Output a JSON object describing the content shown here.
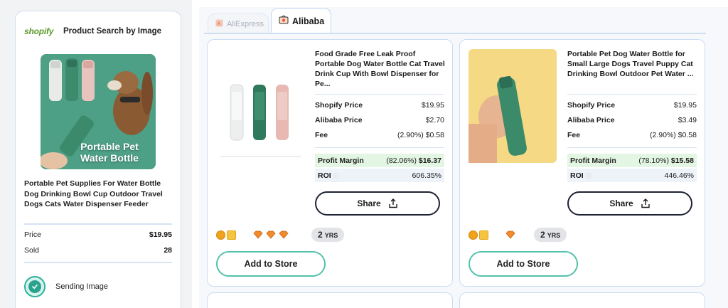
{
  "left_panel": {
    "brand": "shopify",
    "title": "Product Search by Image",
    "image_caption": "Portable Pet Water Bottle",
    "product_name": "Portable Pet Supplies For Water Bottle Dog Drinking Bowl Cup Outdoor Travel Dogs Cats Water Dispenser Feeder",
    "price_label": "Price",
    "price_value": "$19.95",
    "sold_label": "Sold",
    "sold_value": "28",
    "status_label": "Sending Image"
  },
  "tabs": [
    {
      "label": "AliExpress",
      "active": false
    },
    {
      "label": "Alibaba",
      "active": true
    }
  ],
  "cards": [
    {
      "title": "Food Grade Free Leak Proof Portable Dog Water Bottle Cat Travel Drink Cup With Bowl Dispenser for Pe...",
      "shopify_price_label": "Shopify Price",
      "shopify_price": "$19.95",
      "alibaba_price_label": "Alibaba Price",
      "alibaba_price": "$2.70",
      "fee_label": "Fee",
      "fee": "(2.90%) $0.58",
      "profit_label": "Profit Margin",
      "profit_pct": "(82.06%)",
      "profit_value": "$16.37",
      "roi_label": "ROI",
      "roi_value": "606.35%",
      "share_label": "Share",
      "years_num": "2",
      "years_unit": "YRS",
      "gem_count": 3,
      "add_label": "Add to Store"
    },
    {
      "title": "Portable Pet Dog Water Bottle for Small Large Dogs Travel Puppy Cat Drinking Bowl Outdoor Pet Water ...",
      "shopify_price_label": "Shopify Price",
      "shopify_price": "$19.95",
      "alibaba_price_label": "Alibaba Price",
      "alibaba_price": "$3.49",
      "fee_label": "Fee",
      "fee": "(2.90%) $0.58",
      "profit_label": "Profit Margin",
      "profit_pct": "(78.10%)",
      "profit_value": "$15.58",
      "roi_label": "ROI",
      "roi_value": "446.46%",
      "share_label": "Share",
      "years_num": "2",
      "years_unit": "YRS",
      "gem_count": 1,
      "add_label": "Add to Store"
    }
  ],
  "colors": {
    "accent_teal": "#2bb29a",
    "profit_bg": "#e3f6e3",
    "brand_green": "#5c9b2a"
  }
}
